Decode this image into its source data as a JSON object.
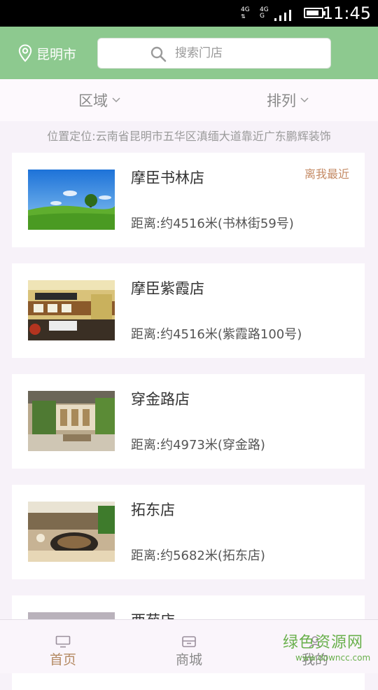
{
  "status_bar": {
    "network_1": "4G",
    "network_2": "4G",
    "network_2_sub": "G",
    "time": "11:45"
  },
  "header": {
    "city": "昆明市",
    "search_placeholder": "搜索门店"
  },
  "filters": {
    "region": "区域",
    "sort": "排列"
  },
  "location_text": "位置定位:云南省昆明市五华区滇缅大道靠近广东鹏辉装饰",
  "stores": [
    {
      "name": "摩臣书林店",
      "distance": "距离:约4516米(书林街59号)",
      "badge": "离我最近",
      "thumb": "landscape-photo"
    },
    {
      "name": "摩臣紫霞店",
      "distance": "距离:约4516米(紫霞路100号)",
      "badge": "",
      "thumb": "store-interior-photo"
    },
    {
      "name": "穿金路店",
      "distance": "距离:约4973米(穿金路)",
      "badge": "",
      "thumb": "store-interior-photo"
    },
    {
      "name": "拓东店",
      "distance": "距离:约5682米(拓东店)",
      "badge": "",
      "thumb": "store-interior-photo"
    },
    {
      "name": "西苑店",
      "distance": "",
      "badge": "",
      "thumb": "store-interior-photo"
    }
  ],
  "tabs": [
    {
      "label": "首页",
      "icon": "monitor-icon"
    },
    {
      "label": "商城",
      "icon": "shop-icon"
    },
    {
      "label": "我的",
      "icon": "user-icon"
    }
  ],
  "watermark": {
    "title": "绿色资源网",
    "url": "www.downcc.com"
  },
  "colors": {
    "header_green": "#8dc98f",
    "tab_active": "#b48a63",
    "badge": "#c48a64"
  }
}
